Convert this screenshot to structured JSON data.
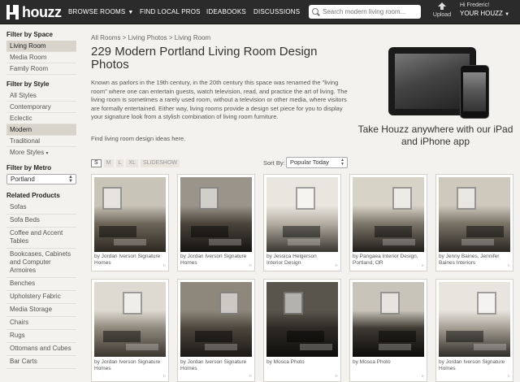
{
  "header": {
    "logo": "houzz",
    "nav": [
      "BROWSE ROOMS",
      "FIND LOCAL PROS",
      "IDEABOOKS",
      "DISCUSSIONS"
    ],
    "search_placeholder": "Search modern living room...",
    "upload": "Upload",
    "greeting": "Hi Frederic!",
    "account": "YOUR HOUZZ"
  },
  "sidebar": {
    "space": {
      "heading": "Filter by Space",
      "items": [
        "Living Room",
        "Media Room",
        "Family Room"
      ]
    },
    "style": {
      "heading": "Filter by Style",
      "items": [
        "All Styles",
        "Contemporary",
        "Eclectic",
        "Modern",
        "Traditional"
      ],
      "more": "More Styles"
    },
    "metro": {
      "heading": "Filter by Metro",
      "value": "Portland"
    },
    "related": {
      "heading": "Related Products",
      "items": [
        "Sofas",
        "Sofa Beds",
        "Coffee and Accent Tables",
        "Bookcases, Cabinets and Computer Armoires",
        "Benches",
        "Upholstery Fabric",
        "Media Storage",
        "Chairs",
        "Rugs",
        "Ottomans and Cubes",
        "Bar Carts"
      ]
    }
  },
  "main": {
    "breadcrumb": "All Rooms > Living Photos > Living Room",
    "title": "229 Modern Portland Living Room Design Photos",
    "description": "Known as parlors in the 19th century, in the 20th century this space was renamed the \"living room\" where one can entertain guests, watch television, read, and practice the art of living. The living room is sometimes a rarely used room, without a television or other media, where visitors are formally entertained. Either way, living rooms provide a design set piece for you to display your signature look from a stylish combination of living room furniture.",
    "find_link": "Find living room design ideas here.",
    "sizes": [
      "S",
      "M",
      "L",
      "XL",
      "SLIDESHOW"
    ],
    "sort_label": "Sort By:",
    "sort_value": "Popular Today"
  },
  "promo": {
    "text": "Take Houzz anywhere with our iPad and iPhone app"
  },
  "photos": [
    {
      "credit": "by Jordan Iverson Signature Homes",
      "tone": [
        "#c9c4b8",
        "#6e6659",
        "#2c2721"
      ]
    },
    {
      "credit": "by Jordan Iverson Signature Homes",
      "tone": [
        "#9a948a",
        "#4a443b",
        "#141210"
      ]
    },
    {
      "credit": "by Jessica Helgerson Interior Design",
      "tone": [
        "#e9e6df",
        "#b3ada2",
        "#3a3630"
      ]
    },
    {
      "credit": "by Pangaea Interior Design, Portland, OR",
      "tone": [
        "#d8d3c7",
        "#7d766a",
        "#1f1c18"
      ]
    },
    {
      "credit": "by Jenny Baines, Jennifer Baines Interiors",
      "tone": [
        "#cfc9bd",
        "#7a7467",
        "#2a2621"
      ]
    },
    {
      "credit": "by Jordan Iverson Signature Homes",
      "tone": [
        "#dedad2",
        "#8f887c",
        "#3a352e"
      ]
    },
    {
      "credit": "by Jordan Iverson Signature Homes",
      "tone": [
        "#8e877b",
        "#4b453c",
        "#1b1815"
      ]
    },
    {
      "credit": "by Mosca Photo",
      "tone": [
        "#5a554c",
        "#2d2a25",
        "#0e0d0b"
      ]
    },
    {
      "credit": "by Mosca Photo",
      "tone": [
        "#c9c4ba",
        "#3e3a33",
        "#0c0b0a"
      ]
    },
    {
      "credit": "by Jordan Iverson Signature Homes",
      "tone": [
        "#e8e5df",
        "#a39d92",
        "#2f2b26"
      ]
    }
  ]
}
